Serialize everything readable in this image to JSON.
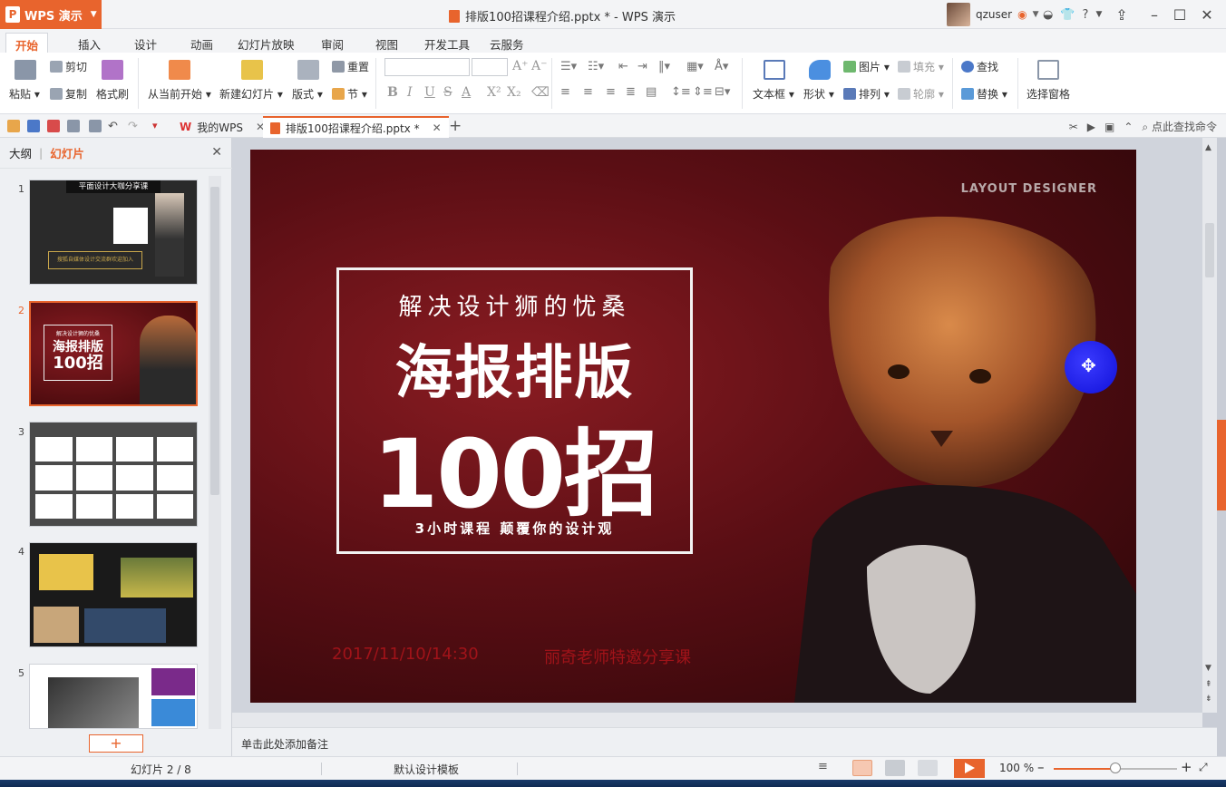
{
  "titlebar": {
    "app_label": "WPS 演示",
    "document_title": "排版100招课程介绍.pptx * - WPS 演示",
    "user_name": "qzuser"
  },
  "menu": {
    "tabs": [
      "开始",
      "插入",
      "设计",
      "动画",
      "幻灯片放映",
      "审阅",
      "视图",
      "开发工具",
      "云服务"
    ],
    "active": "开始"
  },
  "ribbon": {
    "paste": "粘贴",
    "cut": "剪切",
    "copy": "复制",
    "format_painter": "格式刷",
    "from_current": "从当前开始",
    "new_slide": "新建幻灯片",
    "layout": "版式",
    "reset": "重置",
    "section": "节",
    "text_box": "文本框",
    "shape": "形状",
    "picture": "图片",
    "fill": "填充",
    "arrange": "排列",
    "outline": "轮廓",
    "find": "查找",
    "replace": "替换",
    "selection_pane": "选择窗格"
  },
  "tabs": {
    "my_wps": "我的WPS",
    "document": "排版100招课程介绍.pptx *",
    "command_search": "点此查找命令"
  },
  "left_panel": {
    "outline_tab": "大纲",
    "slides_tab": "幻灯片",
    "slide_numbers": [
      "1",
      "2",
      "3",
      "4",
      "5"
    ],
    "thumb1_title": "平面设计大咖分享课",
    "thumb1_banner": "搜狐自媒体设计交流群欢迎加入"
  },
  "slide": {
    "brand": "LAYOUT DESIGNER",
    "subtitle": "解决设计狮的忧桑",
    "heading1": "海报排版",
    "heading2": "100招",
    "tagline": "3小时课程 颠覆你的设计观",
    "date": "2017/11/10/14:30",
    "host": "丽奇老师特邀分享课"
  },
  "notes_placeholder": "单击此处添加备注",
  "status": {
    "slide_counter": "幻灯片 2 / 8",
    "template": "默认设计模板",
    "zoom": "100 %",
    "zoom_level": 0.5
  },
  "colors": {
    "accent": "#e8642d",
    "slide_bg": "#5a0e14",
    "slide_red_text": "#a01319"
  }
}
